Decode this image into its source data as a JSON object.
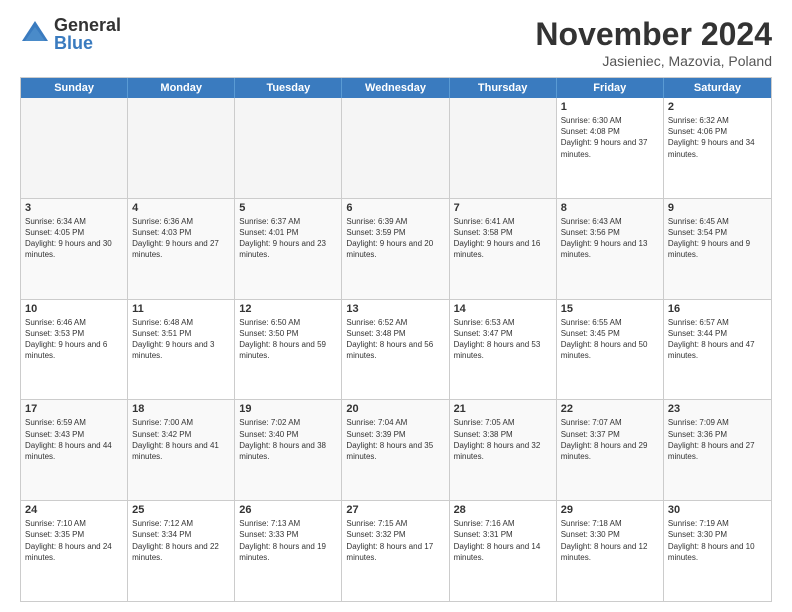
{
  "header": {
    "logo_general": "General",
    "logo_blue": "Blue",
    "month_title": "November 2024",
    "location": "Jasieniec, Mazovia, Poland"
  },
  "days_of_week": [
    "Sunday",
    "Monday",
    "Tuesday",
    "Wednesday",
    "Thursday",
    "Friday",
    "Saturday"
  ],
  "weeks": [
    [
      {
        "day": "",
        "info": "",
        "empty": true
      },
      {
        "day": "",
        "info": "",
        "empty": true
      },
      {
        "day": "",
        "info": "",
        "empty": true
      },
      {
        "day": "",
        "info": "",
        "empty": true
      },
      {
        "day": "",
        "info": "",
        "empty": true
      },
      {
        "day": "1",
        "info": "Sunrise: 6:30 AM\nSunset: 4:08 PM\nDaylight: 9 hours and 37 minutes."
      },
      {
        "day": "2",
        "info": "Sunrise: 6:32 AM\nSunset: 4:06 PM\nDaylight: 9 hours and 34 minutes."
      }
    ],
    [
      {
        "day": "3",
        "info": "Sunrise: 6:34 AM\nSunset: 4:05 PM\nDaylight: 9 hours and 30 minutes."
      },
      {
        "day": "4",
        "info": "Sunrise: 6:36 AM\nSunset: 4:03 PM\nDaylight: 9 hours and 27 minutes."
      },
      {
        "day": "5",
        "info": "Sunrise: 6:37 AM\nSunset: 4:01 PM\nDaylight: 9 hours and 23 minutes."
      },
      {
        "day": "6",
        "info": "Sunrise: 6:39 AM\nSunset: 3:59 PM\nDaylight: 9 hours and 20 minutes."
      },
      {
        "day": "7",
        "info": "Sunrise: 6:41 AM\nSunset: 3:58 PM\nDaylight: 9 hours and 16 minutes."
      },
      {
        "day": "8",
        "info": "Sunrise: 6:43 AM\nSunset: 3:56 PM\nDaylight: 9 hours and 13 minutes."
      },
      {
        "day": "9",
        "info": "Sunrise: 6:45 AM\nSunset: 3:54 PM\nDaylight: 9 hours and 9 minutes."
      }
    ],
    [
      {
        "day": "10",
        "info": "Sunrise: 6:46 AM\nSunset: 3:53 PM\nDaylight: 9 hours and 6 minutes."
      },
      {
        "day": "11",
        "info": "Sunrise: 6:48 AM\nSunset: 3:51 PM\nDaylight: 9 hours and 3 minutes."
      },
      {
        "day": "12",
        "info": "Sunrise: 6:50 AM\nSunset: 3:50 PM\nDaylight: 8 hours and 59 minutes."
      },
      {
        "day": "13",
        "info": "Sunrise: 6:52 AM\nSunset: 3:48 PM\nDaylight: 8 hours and 56 minutes."
      },
      {
        "day": "14",
        "info": "Sunrise: 6:53 AM\nSunset: 3:47 PM\nDaylight: 8 hours and 53 minutes."
      },
      {
        "day": "15",
        "info": "Sunrise: 6:55 AM\nSunset: 3:45 PM\nDaylight: 8 hours and 50 minutes."
      },
      {
        "day": "16",
        "info": "Sunrise: 6:57 AM\nSunset: 3:44 PM\nDaylight: 8 hours and 47 minutes."
      }
    ],
    [
      {
        "day": "17",
        "info": "Sunrise: 6:59 AM\nSunset: 3:43 PM\nDaylight: 8 hours and 44 minutes."
      },
      {
        "day": "18",
        "info": "Sunrise: 7:00 AM\nSunset: 3:42 PM\nDaylight: 8 hours and 41 minutes."
      },
      {
        "day": "19",
        "info": "Sunrise: 7:02 AM\nSunset: 3:40 PM\nDaylight: 8 hours and 38 minutes."
      },
      {
        "day": "20",
        "info": "Sunrise: 7:04 AM\nSunset: 3:39 PM\nDaylight: 8 hours and 35 minutes."
      },
      {
        "day": "21",
        "info": "Sunrise: 7:05 AM\nSunset: 3:38 PM\nDaylight: 8 hours and 32 minutes."
      },
      {
        "day": "22",
        "info": "Sunrise: 7:07 AM\nSunset: 3:37 PM\nDaylight: 8 hours and 29 minutes."
      },
      {
        "day": "23",
        "info": "Sunrise: 7:09 AM\nSunset: 3:36 PM\nDaylight: 8 hours and 27 minutes."
      }
    ],
    [
      {
        "day": "24",
        "info": "Sunrise: 7:10 AM\nSunset: 3:35 PM\nDaylight: 8 hours and 24 minutes."
      },
      {
        "day": "25",
        "info": "Sunrise: 7:12 AM\nSunset: 3:34 PM\nDaylight: 8 hours and 22 minutes."
      },
      {
        "day": "26",
        "info": "Sunrise: 7:13 AM\nSunset: 3:33 PM\nDaylight: 8 hours and 19 minutes."
      },
      {
        "day": "27",
        "info": "Sunrise: 7:15 AM\nSunset: 3:32 PM\nDaylight: 8 hours and 17 minutes."
      },
      {
        "day": "28",
        "info": "Sunrise: 7:16 AM\nSunset: 3:31 PM\nDaylight: 8 hours and 14 minutes."
      },
      {
        "day": "29",
        "info": "Sunrise: 7:18 AM\nSunset: 3:30 PM\nDaylight: 8 hours and 12 minutes."
      },
      {
        "day": "30",
        "info": "Sunrise: 7:19 AM\nSunset: 3:30 PM\nDaylight: 8 hours and 10 minutes."
      }
    ]
  ]
}
